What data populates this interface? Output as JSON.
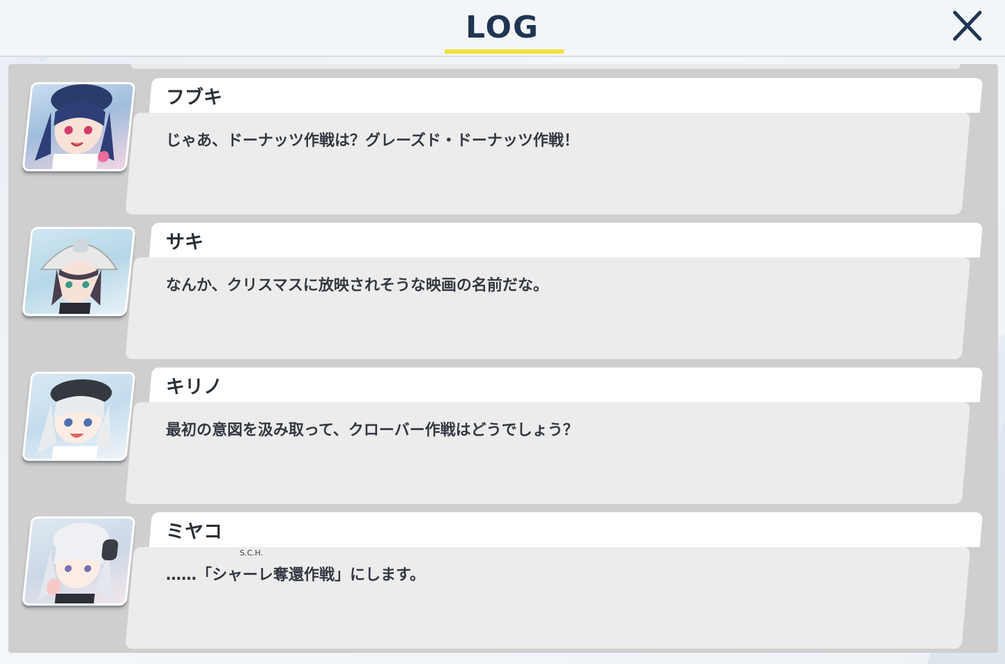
{
  "header": {
    "title": "LOG"
  },
  "entries": [
    {
      "name": "フブキ",
      "text": "じゃあ、ドーナッツ作戦は？グレーズド・ドーナッツ作戦！",
      "avatar_icon": "fubuki-portrait"
    },
    {
      "name": "サキ",
      "text": "なんか、クリスマスに放映されそうな映画の名前だな。",
      "avatar_icon": "saki-portrait"
    },
    {
      "name": "キリノ",
      "text": "最初の意図を汲み取って、クローバー作戦はどうでしょう？",
      "avatar_icon": "kirino-portrait"
    },
    {
      "name": "ミヤコ",
      "text_prefix": "……「",
      "text_ruby_base": "シャーレ",
      "text_ruby": "S.C.H.",
      "text_rest": "奪還作戦」にします。",
      "avatar_icon": "miyako-portrait"
    }
  ],
  "colors": {
    "title": "#1f3552",
    "accent_underline": "#f3e03a",
    "panel": "#cfcfcf",
    "bubble": "#ececec",
    "name_tab": "#ffffff"
  }
}
